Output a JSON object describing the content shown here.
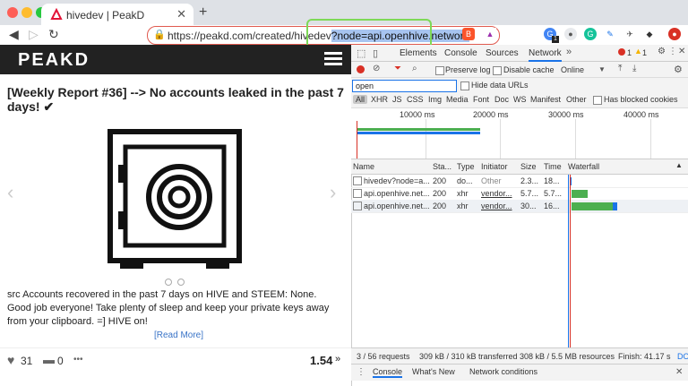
{
  "browser": {
    "tab_title": "hivedev | PeakD",
    "url_base": "https://peakd.com/created/hivedev",
    "url_selected": "?node=api.openhive.network",
    "ext_badge": "1"
  },
  "page": {
    "logo": "PEAKD",
    "post_title": "[Weekly Report #36] --> No accounts leaked in the past 7 days! ✔",
    "post_body": "src Accounts recovered in the past 7 days on HIVE and STEEM: None. Good job everyone! Take plenty of sleep and keep your private keys away from your clipboard.   =] HIVE on!",
    "read_more": "[Read More]",
    "votes": "31",
    "comments": "0",
    "more": "•••",
    "payout": "1.54"
  },
  "devtools": {
    "tabs": [
      "Elements",
      "Console",
      "Sources",
      "Network"
    ],
    "active_tab": "Network",
    "errors": "1",
    "warnings": "1",
    "preserve_log": "Preserve log",
    "disable_cache": "Disable cache",
    "throttle": "Online",
    "filter_value": "open",
    "hide_data_urls": "Hide data URLs",
    "types": [
      "All",
      "XHR",
      "JS",
      "CSS",
      "Img",
      "Media",
      "Font",
      "Doc",
      "WS",
      "Manifest",
      "Other"
    ],
    "has_blocked": "Has blocked cookies",
    "timeline_ticks": [
      "10000 ms",
      "20000 ms",
      "30000 ms",
      "40000 ms"
    ],
    "columns": [
      "Name",
      "Sta...",
      "Type",
      "Initiator",
      "Size",
      "Time",
      "Waterfall"
    ],
    "rows": [
      {
        "name": "hivedev?node=a...",
        "status": "200",
        "type": "do...",
        "initiator": "Other",
        "size": "2.3...",
        "time": "18..."
      },
      {
        "name": "api.openhive.net...",
        "status": "200",
        "type": "xhr",
        "initiator": "vendor...",
        "size": "5.7...",
        "time": "5.7..."
      },
      {
        "name": "api.openhive.net...",
        "status": "200",
        "type": "xhr",
        "initiator": "vendor...",
        "size": "30...",
        "time": "16..."
      }
    ],
    "status_requests": "3 / 56 requests",
    "status_transferred": "309 kB / 310 kB transferred",
    "status_resources": "308 kB / 5.5 MB resources",
    "status_finish": "Finish: 41.17 s",
    "status_dc": "DO",
    "drawer_tabs": [
      "Console",
      "What's New",
      "Network conditions"
    ]
  }
}
